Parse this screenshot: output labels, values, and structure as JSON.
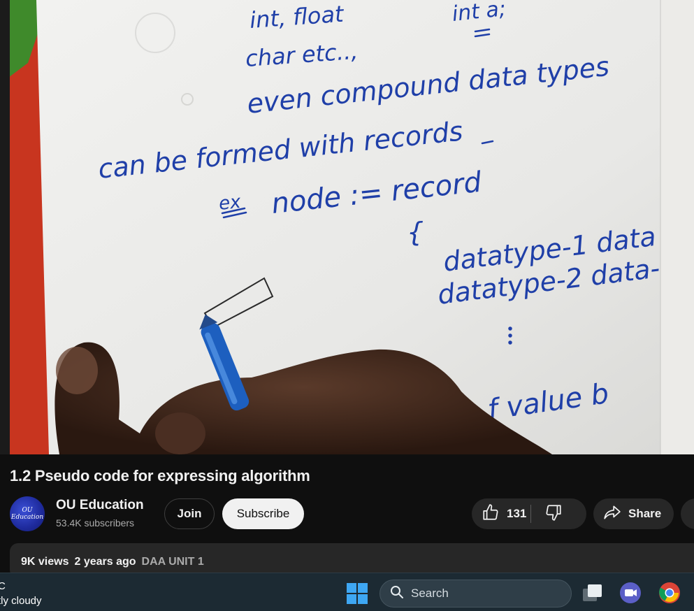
{
  "video": {
    "handwriting": {
      "line1": "int, float",
      "line1b": "int a;",
      "line2": "char etc..,",
      "line3": "even  compound  data types",
      "line4": "can  be  formed  with  records",
      "line5a": "ex",
      "line5b": "node :=  record",
      "line6": "{",
      "line7": "datatype-1  data",
      "line8": "datatype-2  data-",
      "line9": "f  value  b"
    }
  },
  "title": "1.2 Pseudo code for expressing algorithm",
  "channel": {
    "name": "OU Education",
    "subscribers": "53.4K subscribers",
    "avatar_text": "OU Education"
  },
  "buttons": {
    "join": "Join",
    "subscribe": "Subscribe",
    "like_count": "131",
    "share": "Share"
  },
  "description": {
    "views": "9K views",
    "ago": "2 years ago",
    "tag": "DAA UNIT 1"
  },
  "taskbar": {
    "weather_temp": "C",
    "weather_desc": "tly cloudy",
    "search_label": "Search"
  },
  "icons": {
    "like": "thumbs-up-icon",
    "dislike": "thumbs-down-icon",
    "share": "share-arrow-icon",
    "search": "search-icon",
    "start": "windows-start-icon"
  },
  "colors": {
    "background": "#0f0f0f",
    "button_dark": "#272727",
    "subscribe_bg": "#f1f1f1",
    "ink": "#1f3fa8",
    "taskbar": "#1c2a33"
  }
}
